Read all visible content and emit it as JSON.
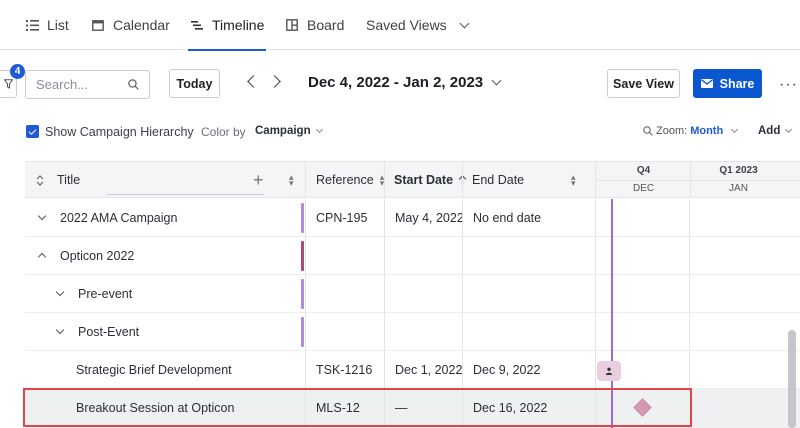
{
  "tabs": [
    {
      "label": "List",
      "icon": "list-icon"
    },
    {
      "label": "Calendar",
      "icon": "calendar-icon"
    },
    {
      "label": "Timeline",
      "icon": "timeline-icon",
      "active": true
    },
    {
      "label": "Board",
      "icon": "board-icon"
    },
    {
      "label": "Saved Views",
      "icon": "chevron-down-icon"
    }
  ],
  "toolbar": {
    "filter_count": "4",
    "search_placeholder": "Search...",
    "today_label": "Today",
    "date_range": "Dec 4, 2022 - Jan 2, 2023",
    "save_view_label": "Save View",
    "share_label": "Share",
    "more_label": "···"
  },
  "options": {
    "show_hierarchy_label": "Show Campaign Hierarchy",
    "show_hierarchy_checked": true,
    "color_by_label": "Color by",
    "color_by_value": "Campaign",
    "zoom_label": "Zoom:",
    "zoom_value": "Month",
    "add_label": "Add"
  },
  "columns": {
    "title": "Title",
    "reference": "Reference",
    "start_date": "Start Date",
    "end_date": "End Date"
  },
  "timeline_header": {
    "quarters": [
      "Q4",
      "Q1 2023"
    ],
    "months": [
      "DEC",
      "JAN"
    ]
  },
  "rows": [
    {
      "title": "2022 AMA Campaign",
      "reference": "CPN-195",
      "start": "May 4, 2022",
      "end": "No end date",
      "color": "#b48ad8"
    },
    {
      "title": "Opticon 2022",
      "reference": "",
      "start": "",
      "end": "",
      "color": "#a94a7a"
    },
    {
      "title": "Pre-event",
      "reference": "",
      "start": "",
      "end": "",
      "color": "#b48ad8"
    },
    {
      "title": "Post-Event",
      "reference": "",
      "start": "",
      "end": "",
      "color": "#b48ad8"
    },
    {
      "title": "Strategic Brief Development",
      "reference": "TSK-1216",
      "start": "Dec 1, 2022",
      "end": "Dec 9, 2022",
      "color": ""
    },
    {
      "title": "Breakout Session at Opticon",
      "reference": "MLS-12",
      "start": "—",
      "end": "Dec 16, 2022",
      "color": ""
    }
  ],
  "colors": {
    "accent": "#1f5bd6",
    "share_button": "#0b57d0",
    "today_line": "#9b6ad6",
    "milestone": "#d39ab4",
    "selection_outline": "#e04646"
  }
}
